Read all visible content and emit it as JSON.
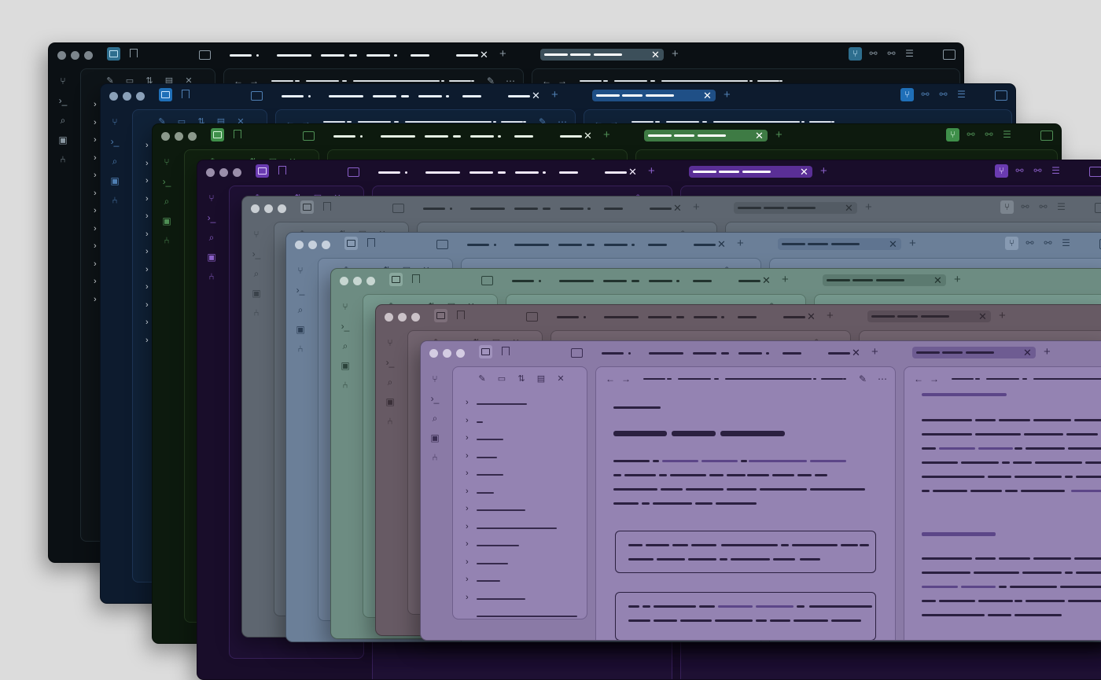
{
  "windows": [
    {
      "theme": "black",
      "bg": "#0b1014",
      "panel": "#0e1418",
      "border": "#1f2a30",
      "tx": "#e8eef2",
      "ic": "#8a98a2",
      "dot": "#7c858c",
      "acc": "#2e6e8e",
      "accfg": "#bfe3f5",
      "pill": "#3c4f5a",
      "pilltx": "#ffffff",
      "link": "#9ab"
    },
    {
      "theme": "navy",
      "bg": "#0d1b2e",
      "panel": "#102238",
      "border": "#1d3555",
      "tx": "#e8f0fa",
      "ic": "#4f7fb3",
      "dot": "#8aa0b8",
      "acc": "#1f6fb8",
      "accfg": "#cde6ff",
      "pill": "#1f4f86",
      "pilltx": "#ffffff",
      "link": "#8ab"
    },
    {
      "theme": "forest",
      "bg": "#0d1a0e",
      "panel": "#10200f",
      "border": "#23391f",
      "tx": "#e6f1e4",
      "ic": "#4f8f55",
      "dot": "#8c998c",
      "acc": "#3f8f4a",
      "accfg": "#d6f5da",
      "pill": "#3e7b44",
      "pilltx": "#ffffff",
      "link": "#8b8"
    },
    {
      "theme": "violet-dark",
      "bg": "#190d2a",
      "panel": "#1e1033",
      "border": "#38215a",
      "tx": "#f0e8fa",
      "ic": "#8a5fc8",
      "dot": "#9a8eaa",
      "acc": "#6a3bb0",
      "accfg": "#e6d6ff",
      "pill": "#5a2f96",
      "pilltx": "#ffffff",
      "link": "#a9c"
    },
    {
      "theme": "slate",
      "bg": "#5e6670",
      "panel": "#66707b",
      "border": "#4c545d",
      "tx": "#2c3238",
      "ic": "#3a424a",
      "dot": "#c9ced3",
      "acc": "#7b848e",
      "accfg": "#2c3238",
      "pill": "#535b64",
      "pilltx": "#2c3238",
      "link": "#3e4750"
    },
    {
      "theme": "steel-blue",
      "bg": "#6b7f98",
      "panel": "#7488a2",
      "border": "#566a82",
      "tx": "#233448",
      "ic": "#2d3f55",
      "dot": "#c6d0dc",
      "acc": "#879ab2",
      "accfg": "#233448",
      "pill": "#5f7490",
      "pilltx": "#233448",
      "link": "#2f4460"
    },
    {
      "theme": "sage",
      "bg": "#6d8c82",
      "panel": "#779a8f",
      "border": "#587569",
      "tx": "#22332e",
      "ic": "#2c433b",
      "dot": "#c7d6d1",
      "acc": "#8aa89e",
      "accfg": "#22332e",
      "pill": "#5c7a70",
      "pilltx": "#22332e",
      "link": "#2c4a40"
    },
    {
      "theme": "mauve",
      "bg": "#675a64",
      "panel": "#72646f",
      "border": "#544952",
      "tx": "#2e2630",
      "ic": "#3a3038",
      "dot": "#cbc2c8",
      "acc": "#7d6f7a",
      "accfg": "#2e2630",
      "pill": "#5a4e58",
      "pilltx": "#2e2630",
      "link": "#3c3040"
    },
    {
      "theme": "lavender",
      "bg": "#8a7aa6",
      "panel": "#9483b2",
      "border": "#6f5f8c",
      "tx": "#2b2040",
      "ic": "#3a2d52",
      "dot": "#d4cce2",
      "acc": "#a193bd",
      "accfg": "#2b2040",
      "pill": "#6e5c92",
      "pilltx": "#2b2040",
      "link": "#5c4688"
    }
  ],
  "icons": {
    "ribbon": [
      "graph-icon",
      "terminal-icon",
      "search-icon",
      "cards-icon",
      "git-icon"
    ],
    "titlebar_right": [
      "graph-view-icon",
      "link-icon",
      "link-unlink-icon",
      "list-icon",
      "right-sidebar-icon"
    ],
    "explorer_toolbar": [
      "new-note-icon",
      "new-folder-icon",
      "sort-icon",
      "collapse-icon",
      "close-icon"
    ]
  }
}
